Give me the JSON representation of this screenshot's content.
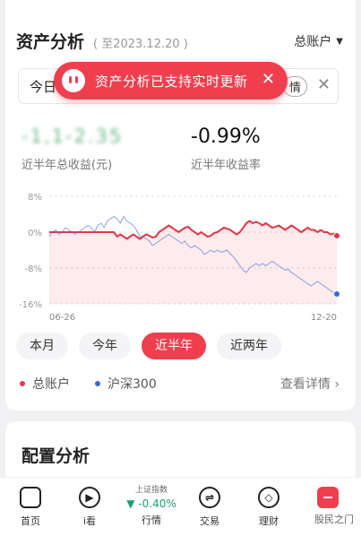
{
  "header": {
    "title": "资产分析",
    "as_of": "( 至2023.12.20 )",
    "account_selector": "总账户"
  },
  "notice": {
    "left_text": "今日",
    "detail_label": "情"
  },
  "toast": {
    "text": "资产分析已支持实时更新"
  },
  "metrics": {
    "total_profit_value": "-1,1-2.35",
    "total_profit_label": "近半年总收益(元)",
    "rate_value": "-0.99%",
    "rate_label": "近半年收益率"
  },
  "range_tabs": [
    {
      "label": "本月",
      "active": false
    },
    {
      "label": "今年",
      "active": false
    },
    {
      "label": "近半年",
      "active": true
    },
    {
      "label": "近两年",
      "active": false
    }
  ],
  "legend": {
    "account": {
      "label": "总账户",
      "color": "#e23a48"
    },
    "index": {
      "label": "沪深300",
      "color": "#3b66d8"
    },
    "details_link": "查看详情"
  },
  "section2": {
    "title": "配置分析"
  },
  "nav": {
    "home": "首页",
    "watch": "i看",
    "market_index_name": "上证指数",
    "market_index_change": "▼ -0.40%",
    "market": "行情",
    "trade": "交易",
    "wealth": "理财",
    "watermark": "股民之门"
  },
  "chart_data": {
    "type": "line",
    "x_start_label": "06-26",
    "x_end_label": "12-20",
    "ylabels": [
      "8%",
      "0%",
      "-8%",
      "-16%"
    ],
    "ylim": [
      -16,
      8
    ],
    "series": [
      {
        "name": "总账户",
        "color": "#e23a48",
        "fill": true,
        "values": [
          0.0,
          0.0,
          0.0,
          0.0,
          0.0,
          0.0,
          0.0,
          0.0,
          0.0,
          0.0,
          0.0,
          0.0,
          0.0,
          0.0,
          0.0,
          0.0,
          0.0,
          0.0,
          0.0,
          0.0,
          0.0,
          -1.0,
          -0.5,
          -1.0,
          -1.5,
          -1.0,
          -0.5,
          -1.0,
          -1.5,
          -1.0,
          -0.5,
          -0.8,
          -1.2,
          -1.0,
          0.0,
          0.5,
          1.0,
          1.5,
          1.0,
          0.5,
          0.0,
          0.5,
          1.0,
          1.2,
          0.5,
          0.0,
          -0.5,
          0.0,
          -0.5,
          -1.0,
          -0.8,
          -0.2,
          0.0,
          0.5,
          1.0,
          0.8,
          0.5,
          0.0,
          -0.5,
          0.0,
          1.0,
          2.0,
          2.5,
          2.0,
          2.3,
          2.0,
          1.5,
          2.0,
          1.5,
          1.0,
          1.2,
          1.5,
          1.0,
          0.5,
          1.0,
          1.5,
          1.0,
          0.5,
          0.0,
          0.5,
          1.0,
          0.5,
          0.5,
          0.0,
          0.5,
          0.0,
          0.0,
          -0.5,
          -0.3,
          -0.8
        ]
      },
      {
        "name": "沪深300",
        "color": "#3b66d8",
        "fill": false,
        "values": [
          -1.0,
          0.0,
          0.5,
          -0.5,
          0.0,
          1.0,
          0.5,
          0.0,
          -0.5,
          0.0,
          0.5,
          1.0,
          1.5,
          1.0,
          0.0,
          1.5,
          2.0,
          1.0,
          2.5,
          3.0,
          3.5,
          3.0,
          2.0,
          3.5,
          2.5,
          2.0,
          1.5,
          0.5,
          -1.0,
          -1.0,
          -1.5,
          -2.0,
          -3.0,
          -2.5,
          -2.0,
          -1.5,
          -1.0,
          -0.5,
          -1.0,
          -1.5,
          -2.0,
          -2.5,
          -2.0,
          -3.0,
          -3.5,
          -3.0,
          -3.5,
          -4.0,
          -5.0,
          -4.5,
          -4.0,
          -4.5,
          -4.0,
          -4.5,
          -4.3,
          -4.0,
          -4.8,
          -5.5,
          -6.5,
          -7.5,
          -8.5,
          -9.0,
          -8.0,
          -7.5,
          -7.0,
          -7.5,
          -7.0,
          -7.5,
          -7.0,
          -6.5,
          -7.0,
          -7.5,
          -8.0,
          -8.5,
          -8.3,
          -9.0,
          -9.5,
          -10.0,
          -10.5,
          -11.0,
          -11.5,
          -12.0,
          -11.5,
          -11.0,
          -11.5,
          -12.0,
          -12.5,
          -13.0,
          -13.5,
          -13.8
        ]
      }
    ]
  }
}
